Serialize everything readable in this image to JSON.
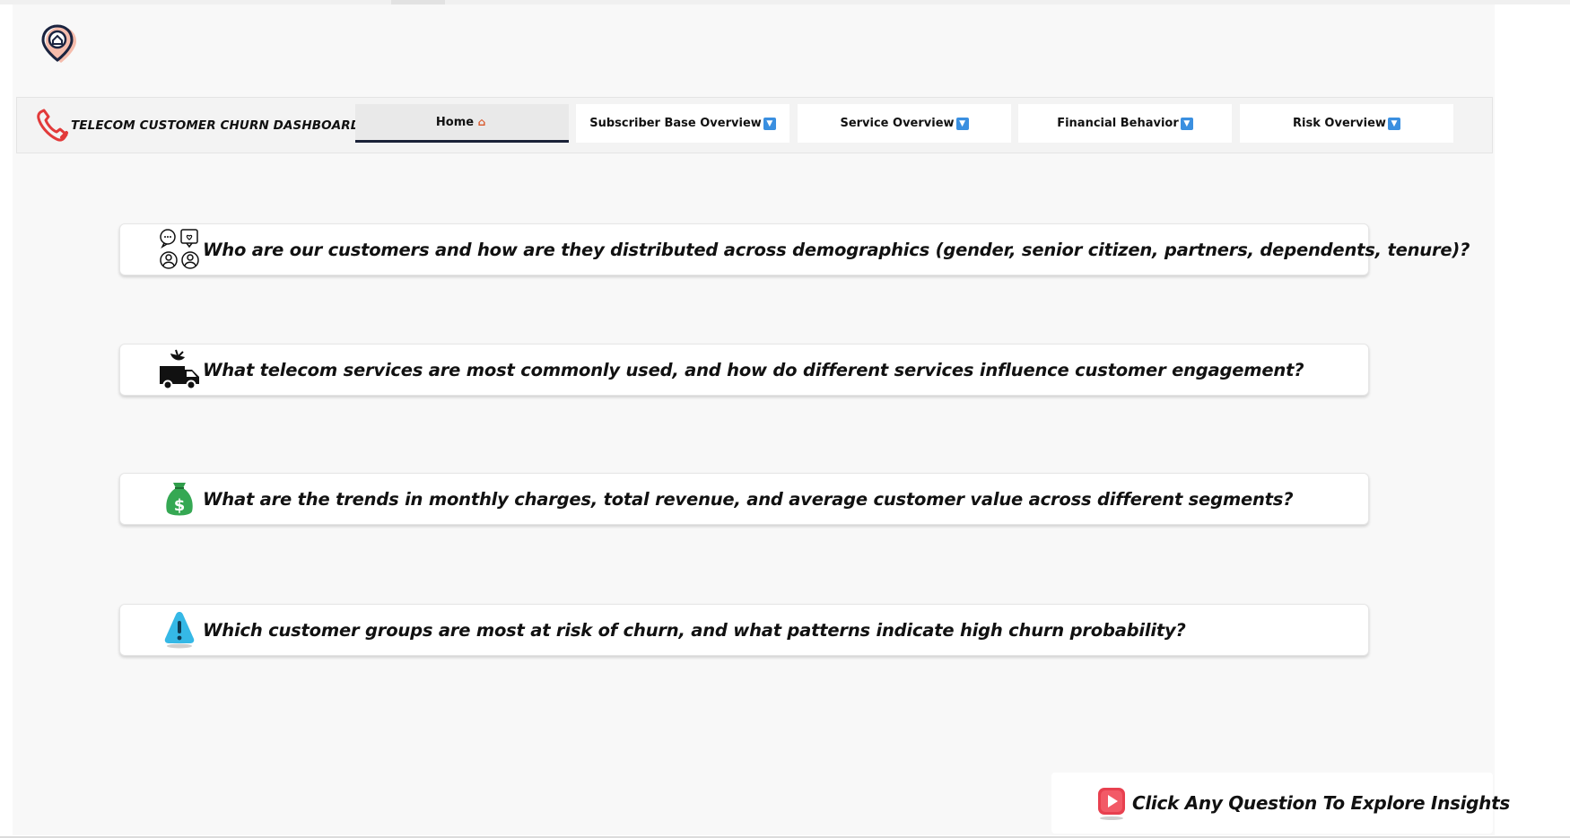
{
  "header": {
    "logo_icon": "location-home-pin-icon",
    "brand_icon": "phone-receiver-icon",
    "title": "TELECOM CUSTOMER CHURN DASHBOARD"
  },
  "nav": {
    "tabs": [
      {
        "label": "Home",
        "icon": "house-icon",
        "active": true
      },
      {
        "label": "Subscriber Base Overview",
        "icon": "down-arrow-button-icon",
        "active": false
      },
      {
        "label": "Service Overview",
        "icon": "down-arrow-button-icon",
        "active": false
      },
      {
        "label": "Financial Behavior",
        "icon": "down-arrow-button-icon",
        "active": false
      },
      {
        "label": "Risk Overview",
        "icon": "down-arrow-button-icon",
        "active": false
      }
    ]
  },
  "questions": [
    {
      "icon": "people-chat-icon",
      "text": "Who are our customers and how are they distributed across demographics (gender, senior citizen, partners, dependents, tenure)?"
    },
    {
      "icon": "satellite-van-icon",
      "text": "What telecom services are most commonly used, and how do different services influence customer engagement?"
    },
    {
      "icon": "money-bag-icon",
      "text": "What are the trends in monthly charges, total revenue, and average customer value across different segments?"
    },
    {
      "icon": "warning-cone-icon",
      "text": "Which customer groups are most at risk of churn, and what patterns indicate high churn probability?"
    }
  ],
  "cta": {
    "icon": "play-button-icon",
    "text": "Click Any Question To Explore Insights"
  },
  "colors": {
    "active_tab_underline": "#1a2238",
    "canvas_bg": "#f8f8f8",
    "tab_arrow": "#3a8fe0"
  }
}
